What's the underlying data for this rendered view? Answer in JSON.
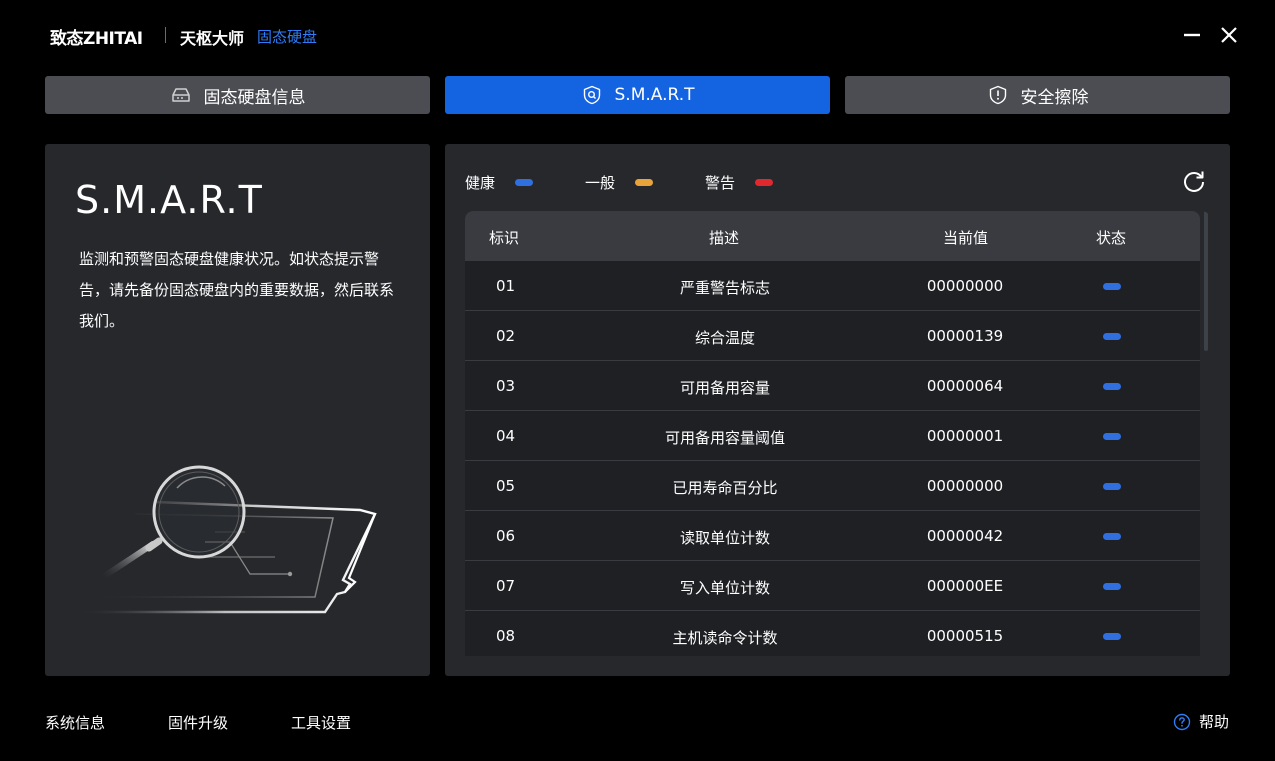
{
  "header": {
    "brand_logo": "致态ZHITAI",
    "app_name": "天枢大师",
    "product": "固态硬盘"
  },
  "tabs": [
    {
      "label": "固态硬盘信息",
      "icon": "drive-icon",
      "active": false
    },
    {
      "label": "S.M.A.R.T",
      "icon": "shield-search-icon",
      "active": true
    },
    {
      "label": "安全擦除",
      "icon": "shield-alert-icon",
      "active": false
    }
  ],
  "left_panel": {
    "title": "S.M.A.R.T",
    "description": "监测和预警固态硬盘健康状况。如状态提示警告，请先备份固态硬盘内的重要数据，然后联系我们。"
  },
  "legend": [
    {
      "label": "健康",
      "color": "#2f6fe0"
    },
    {
      "label": "一般",
      "color": "#e8a33a"
    },
    {
      "label": "警告",
      "color": "#e0282e"
    }
  ],
  "table": {
    "headers": {
      "id": "标识",
      "desc": "描述",
      "value": "当前值",
      "status": "状态"
    },
    "rows": [
      {
        "id": "01",
        "desc": "严重警告标志",
        "value": "00000000",
        "status": "healthy"
      },
      {
        "id": "02",
        "desc": "综合温度",
        "value": "00000139",
        "status": "healthy"
      },
      {
        "id": "03",
        "desc": "可用备用容量",
        "value": "00000064",
        "status": "healthy"
      },
      {
        "id": "04",
        "desc": "可用备用容量阈值",
        "value": "00000001",
        "status": "healthy"
      },
      {
        "id": "05",
        "desc": "已用寿命百分比",
        "value": "00000000",
        "status": "healthy"
      },
      {
        "id": "06",
        "desc": "读取单位计数",
        "value": "00000042",
        "status": "healthy"
      },
      {
        "id": "07",
        "desc": "写入单位计数",
        "value": "000000EE",
        "status": "healthy"
      },
      {
        "id": "08",
        "desc": "主机读命令计数",
        "value": "00000515",
        "status": "healthy"
      }
    ]
  },
  "footer": {
    "system_info": "系统信息",
    "firmware_upgrade": "固件升级",
    "tool_settings": "工具设置",
    "help": "帮助"
  },
  "colors": {
    "accent": "#1463e1",
    "healthy": "#2f6fe0",
    "normal": "#e8a33a",
    "warning": "#e0282e"
  }
}
